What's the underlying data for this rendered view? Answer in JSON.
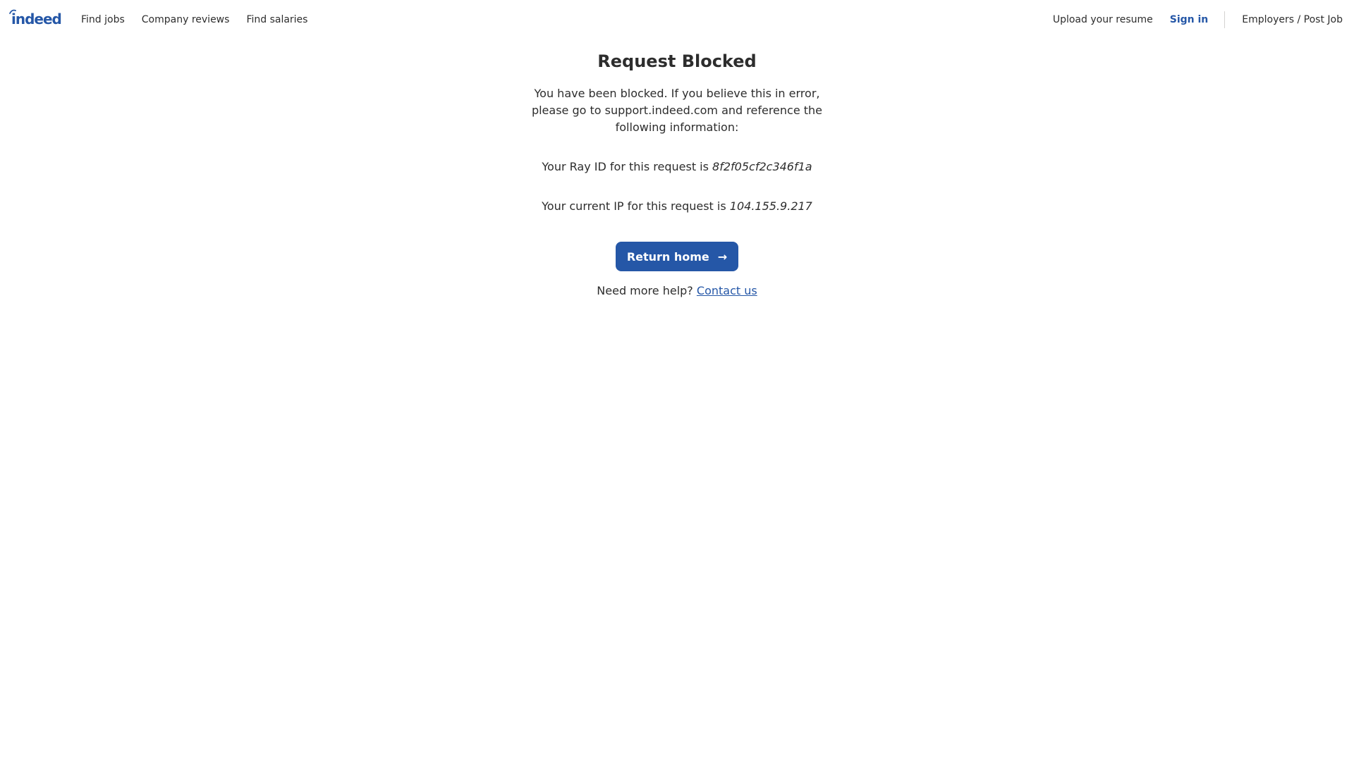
{
  "header": {
    "logo_text": "indeed",
    "nav_left": [
      "Find jobs",
      "Company reviews",
      "Find salaries"
    ],
    "upload_resume": "Upload your resume",
    "sign_in": "Sign in",
    "employers": "Employers / Post Job"
  },
  "main": {
    "title": "Request Blocked",
    "message": "You have been blocked. If you believe this in error, please go to support.indeed.com and reference the following information:",
    "ray_prefix": "Your Ray ID for this request is",
    "ray_id": "8f2f05cf2c346f1a",
    "ip_prefix": "Your current IP for this request is",
    "ip": "104.155.9.217",
    "button_label": "Return home",
    "button_icon": "→",
    "help_text": "Need more help?",
    "contact_link": "Contact us"
  },
  "colors": {
    "brand": "#2557a7",
    "text": "#2d2d2d",
    "divider": "#d4d2d0"
  }
}
